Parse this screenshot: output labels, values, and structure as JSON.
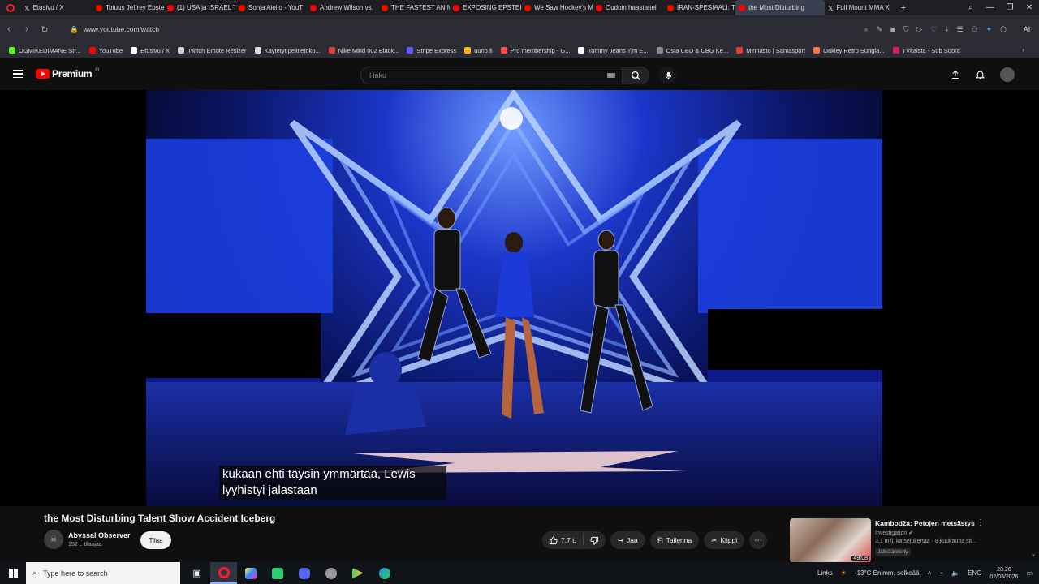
{
  "browser": {
    "tabs": [
      {
        "label": "Etusivu / X",
        "icon": "x-icon",
        "color": "#ffffff"
      },
      {
        "label": "Totuus Jeffrey Epste",
        "icon": "youtube-icon",
        "color": "#ff0000"
      },
      {
        "label": "(1) USA ja ISRAEL Tc",
        "icon": "youtube-icon",
        "color": "#ff0000"
      },
      {
        "label": "Sonja Aiello - YouT",
        "icon": "youtube-icon",
        "color": "#ff0000"
      },
      {
        "label": "Andrew Wilson vs.",
        "icon": "youtube-icon",
        "color": "#ff0000"
      },
      {
        "label": "THE FASTEST ANIM",
        "icon": "youtube-icon",
        "color": "#ff0000"
      },
      {
        "label": "EXPOSING EPSTEIN",
        "icon": "youtube-icon",
        "color": "#ff0000"
      },
      {
        "label": "We Saw Hockey's M",
        "icon": "youtube-icon",
        "color": "#ff0000"
      },
      {
        "label": "Oudoin haastattel",
        "icon": "youtube-icon",
        "color": "#ff0000"
      },
      {
        "label": "IRAN-SPESIAALI: Ti",
        "icon": "youtube-icon",
        "color": "#ff0000"
      },
      {
        "label": "the Most Disturbing",
        "icon": "youtube-icon",
        "color": "#ff0000",
        "active": true
      },
      {
        "label": "Full Mount MMA X",
        "icon": "x-icon",
        "color": "#ffffff"
      }
    ],
    "url": "www.youtube.com/watch",
    "ai_label": "AI"
  },
  "bookmarks": [
    {
      "label": "OGMIKEDIMANE Str...",
      "color": "#53fc18"
    },
    {
      "label": "YouTube",
      "color": "#ff0000"
    },
    {
      "label": "Etusivu / X",
      "color": "#ffffff"
    },
    {
      "label": "Twitch Emote Resizer",
      "color": "#cccccc"
    },
    {
      "label": "Käytetyt pelitietoko...",
      "color": "#dddddd"
    },
    {
      "label": "Nike Mind 002 Black...",
      "color": "#e04040"
    },
    {
      "label": "Stripe Express",
      "color": "#635bff"
    },
    {
      "label": "uuno.fi",
      "color": "#ffb300"
    },
    {
      "label": "Pro membership - G...",
      "color": "#ff4d4d"
    },
    {
      "label": "Tommy Jeans Tjm E...",
      "color": "#ffffff"
    },
    {
      "label": "Osta CBD & CBG Ke...",
      "color": "#888888"
    },
    {
      "label": "Minnasto | Santasport",
      "color": "#e53935"
    },
    {
      "label": "Oakley Retro Sungla...",
      "color": "#ff7043"
    },
    {
      "label": "TVkaista - Sub Suora",
      "color": "#d81b60"
    }
  ],
  "youtube": {
    "logo_text": "Premium",
    "logo_sup": "FI",
    "search_placeholder": "Haku"
  },
  "video": {
    "subtitle_line1": "kukaan ehti täysin ymmärtää, Lewis",
    "subtitle_line2": "lyyhistyi jalastaan",
    "title": "the Most Disturbing Talent Show Accident Iceberg",
    "channel": "Abyssal Observer",
    "subscribers": "152 t. tilaajaa",
    "subscribe_label": "Tilaa",
    "likes": "7,7 t.",
    "share_label": "Jaa",
    "save_label": "Tallenna",
    "clip_label": "Klippi"
  },
  "recommendation": {
    "title": "Kambodža: Petojen metsästys",
    "channel": "Investigation",
    "meta": "3,1 milj. katselukertaa · 8 kuukautta sit...",
    "badge": "Jälkiäänitetty",
    "duration": "49:08"
  },
  "taskbar": {
    "search_placeholder": "Type here to search",
    "links_label": "Links",
    "weather": "-13°C  Enimm. selkeää",
    "lang": "ENG",
    "time": "23.26",
    "date": "02/03/2026"
  }
}
